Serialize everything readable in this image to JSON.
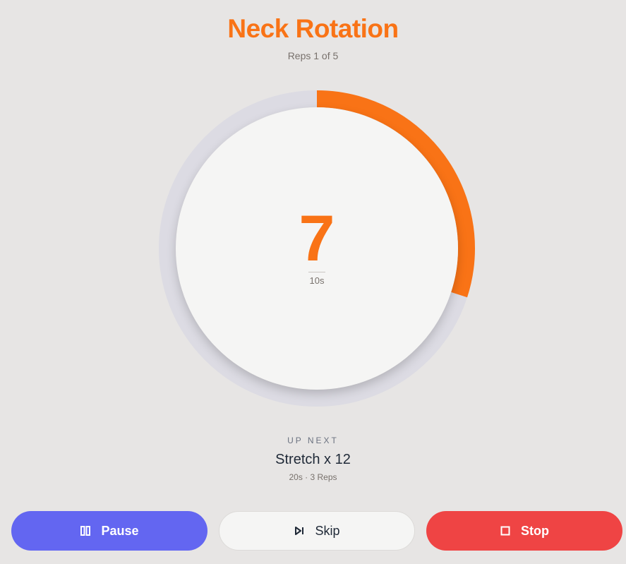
{
  "exercise": {
    "title": "Neck Rotation",
    "reps_status": "Reps 1 of 5"
  },
  "timer": {
    "remaining": "7",
    "total": "10s",
    "progress_fraction": 0.3,
    "track_color": "#dcdbe3",
    "progress_color": "#f97316"
  },
  "up_next": {
    "label": "UP NEXT",
    "name": "Stretch x 12",
    "meta": "20s · 3 Reps"
  },
  "controls": {
    "pause_label": "Pause",
    "pause_icon": "pause-icon",
    "skip_label": "Skip",
    "skip_icon": "skip-next-icon",
    "stop_label": "Stop",
    "stop_icon": "stop-icon"
  },
  "colors": {
    "accent": "#f97316",
    "pause": "#6366f1",
    "stop": "#ef4444"
  }
}
